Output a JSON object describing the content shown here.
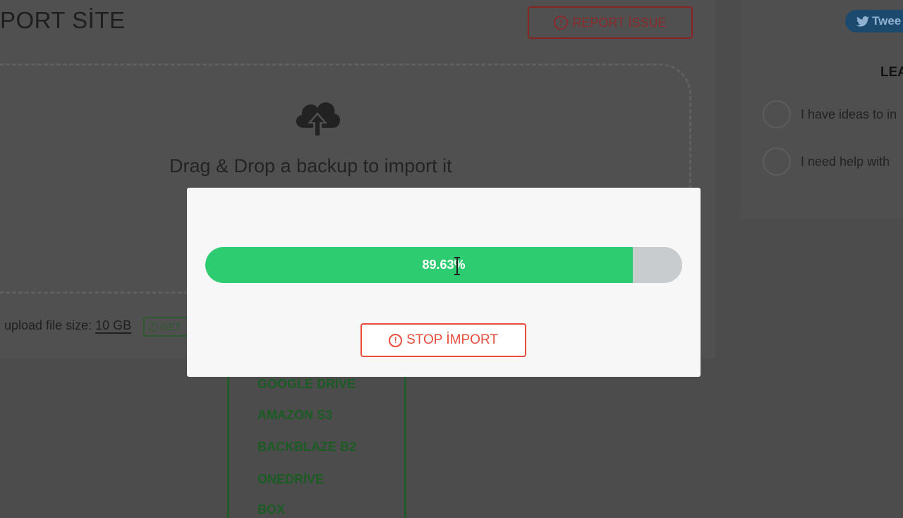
{
  "page": {
    "title": "PORT SİTE",
    "report_button": "REPORT İSSUE",
    "drop_text": "Drag & Drop a backup to import it",
    "upload_size_label": "upload file size:",
    "upload_size_value": "10 GB",
    "get_badge": "GET",
    "storage_items": [
      "GOOGLE DRIVE",
      "AMAZON S3",
      "BACKBLAZE B2",
      "ONEDRİVE",
      "BOX"
    ]
  },
  "sidebar": {
    "tweet_button": "Twee",
    "heading": "LEA",
    "options": [
      "I have ideas to in",
      "I need help with"
    ]
  },
  "modal": {
    "progress_text": "89.63%",
    "progress_value": 0.8963,
    "stop_button": "STOP İMPORT"
  },
  "colors": {
    "progress_fill": "#2ecc71",
    "progress_track": "#c8ccce",
    "stop_accent": "#e74c3c",
    "overlay_background": "#4c4c4c"
  },
  "icons": {
    "report": "exclamation-circle-icon",
    "upload": "cloud-upload-icon",
    "tweet": "twitter-icon",
    "stop": "exclamation-circle-icon",
    "cursor": "text-cursor-icon"
  }
}
